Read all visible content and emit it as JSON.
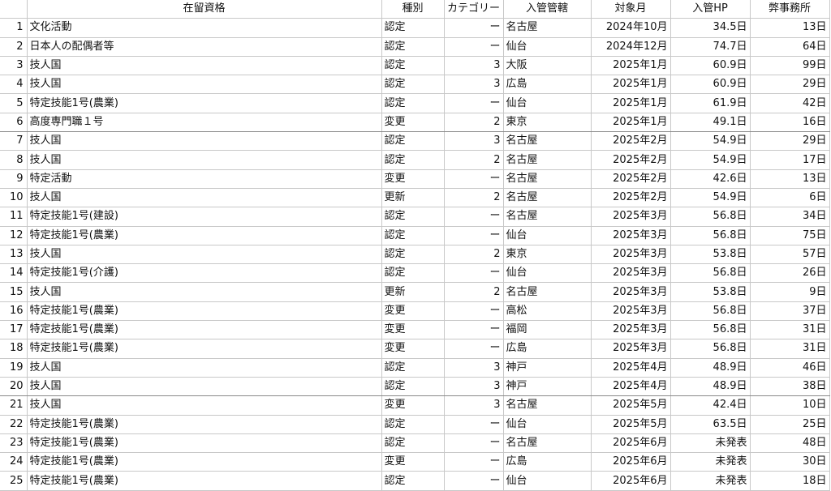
{
  "columns": [
    "",
    "在留資格",
    "種別",
    "カテゴリー",
    "入管管轄",
    "対象月",
    "入管HP",
    "弊事務所"
  ],
  "rows": [
    [
      "1",
      "文化活動",
      "認定",
      "ー",
      "名古屋",
      "2024年10月",
      "34.5日",
      "13日"
    ],
    [
      "2",
      "日本人の配偶者等",
      "認定",
      "ー",
      "仙台",
      "2024年12月",
      "74.7日",
      "64日"
    ],
    [
      "3",
      "技人国",
      "認定",
      "3",
      "大阪",
      "2025年1月",
      "60.9日",
      "99日"
    ],
    [
      "4",
      "技人国",
      "認定",
      "3",
      "広島",
      "2025年1月",
      "60.9日",
      "29日"
    ],
    [
      "5",
      "特定技能1号(農業)",
      "認定",
      "ー",
      "仙台",
      "2025年1月",
      "61.9日",
      "42日"
    ],
    [
      "6",
      "高度専門職１号",
      "変更",
      "2",
      "東京",
      "2025年1月",
      "49.1日",
      "16日"
    ],
    [
      "7",
      "技人国",
      "認定",
      "3",
      "名古屋",
      "2025年2月",
      "54.9日",
      "29日"
    ],
    [
      "8",
      "技人国",
      "認定",
      "2",
      "名古屋",
      "2025年2月",
      "54.9日",
      "17日"
    ],
    [
      "9",
      "特定活動",
      "変更",
      "ー",
      "名古屋",
      "2025年2月",
      "42.6日",
      "13日"
    ],
    [
      "10",
      "技人国",
      "更新",
      "2",
      "名古屋",
      "2025年2月",
      "54.9日",
      "6日"
    ],
    [
      "11",
      "特定技能1号(建設)",
      "認定",
      "ー",
      "名古屋",
      "2025年3月",
      "56.8日",
      "34日"
    ],
    [
      "12",
      "特定技能1号(農業)",
      "認定",
      "ー",
      "仙台",
      "2025年3月",
      "56.8日",
      "75日"
    ],
    [
      "13",
      "技人国",
      "認定",
      "2",
      "東京",
      "2025年3月",
      "53.8日",
      "57日"
    ],
    [
      "14",
      "特定技能1号(介護)",
      "認定",
      "ー",
      "仙台",
      "2025年3月",
      "56.8日",
      "26日"
    ],
    [
      "15",
      "技人国",
      "更新",
      "2",
      "名古屋",
      "2025年3月",
      "53.8日",
      "9日"
    ],
    [
      "16",
      "特定技能1号(農業)",
      "変更",
      "ー",
      "高松",
      "2025年3月",
      "56.8日",
      "37日"
    ],
    [
      "17",
      "特定技能1号(農業)",
      "変更",
      "ー",
      "福岡",
      "2025年3月",
      "56.8日",
      "31日"
    ],
    [
      "18",
      "特定技能1号(農業)",
      "変更",
      "ー",
      "広島",
      "2025年3月",
      "56.8日",
      "31日"
    ],
    [
      "19",
      "技人国",
      "認定",
      "3",
      "神戸",
      "2025年4月",
      "48.9日",
      "46日"
    ],
    [
      "20",
      "技人国",
      "認定",
      "3",
      "神戸",
      "2025年4月",
      "48.9日",
      "38日"
    ],
    [
      "21",
      "技人国",
      "変更",
      "3",
      "名古屋",
      "2025年5月",
      "42.4日",
      "10日"
    ],
    [
      "22",
      "特定技能1号(農業)",
      "認定",
      "ー",
      "仙台",
      "2025年5月",
      "63.5日",
      "25日"
    ],
    [
      "23",
      "特定技能1号(農業)",
      "認定",
      "ー",
      "名古屋",
      "2025年6月",
      "未発表",
      "48日"
    ],
    [
      "24",
      "特定技能1号(農業)",
      "変更",
      "ー",
      "広島",
      "2025年6月",
      "未発表",
      "30日"
    ],
    [
      "25",
      "特定技能1号(農業)",
      "認定",
      "ー",
      "仙台",
      "2025年6月",
      "未発表",
      "18日"
    ]
  ]
}
